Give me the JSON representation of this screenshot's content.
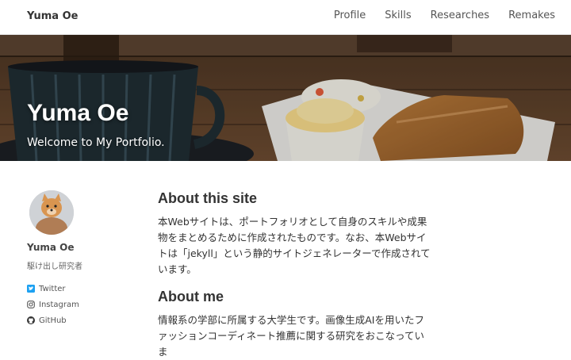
{
  "navbar": {
    "brand": "Yuma Oe",
    "links": [
      {
        "label": "Profile"
      },
      {
        "label": "Skills"
      },
      {
        "label": "Researches"
      },
      {
        "label": "Remakes"
      }
    ]
  },
  "hero": {
    "title": "Yuma Oe",
    "subtitle": "Welcome to My Portfolio."
  },
  "author": {
    "name": "Yuma Oe",
    "bio": "駆け出し研究者",
    "links": [
      {
        "label": "Twitter",
        "icon": "twitter-icon",
        "color": "#1da1f2"
      },
      {
        "label": "Instagram",
        "icon": "instagram-icon",
        "color": "#555555"
      },
      {
        "label": "GitHub",
        "icon": "github-icon",
        "color": "#333333"
      }
    ]
  },
  "content": {
    "about_site": {
      "title": "About this site",
      "text": "本Webサイトは、ポートフォリオとして自身のスキルや成果物をまとめるために作成されたものです。なお、本Webサイトは「jekyll」という静的サイトジェネレーターで作成されています。"
    },
    "about_me": {
      "title": "About me",
      "text": "情報系の学部に所属する大学生です。画像生成AIを用いたファッションコーディネート推薦に関する研究をおこなっていま"
    }
  }
}
